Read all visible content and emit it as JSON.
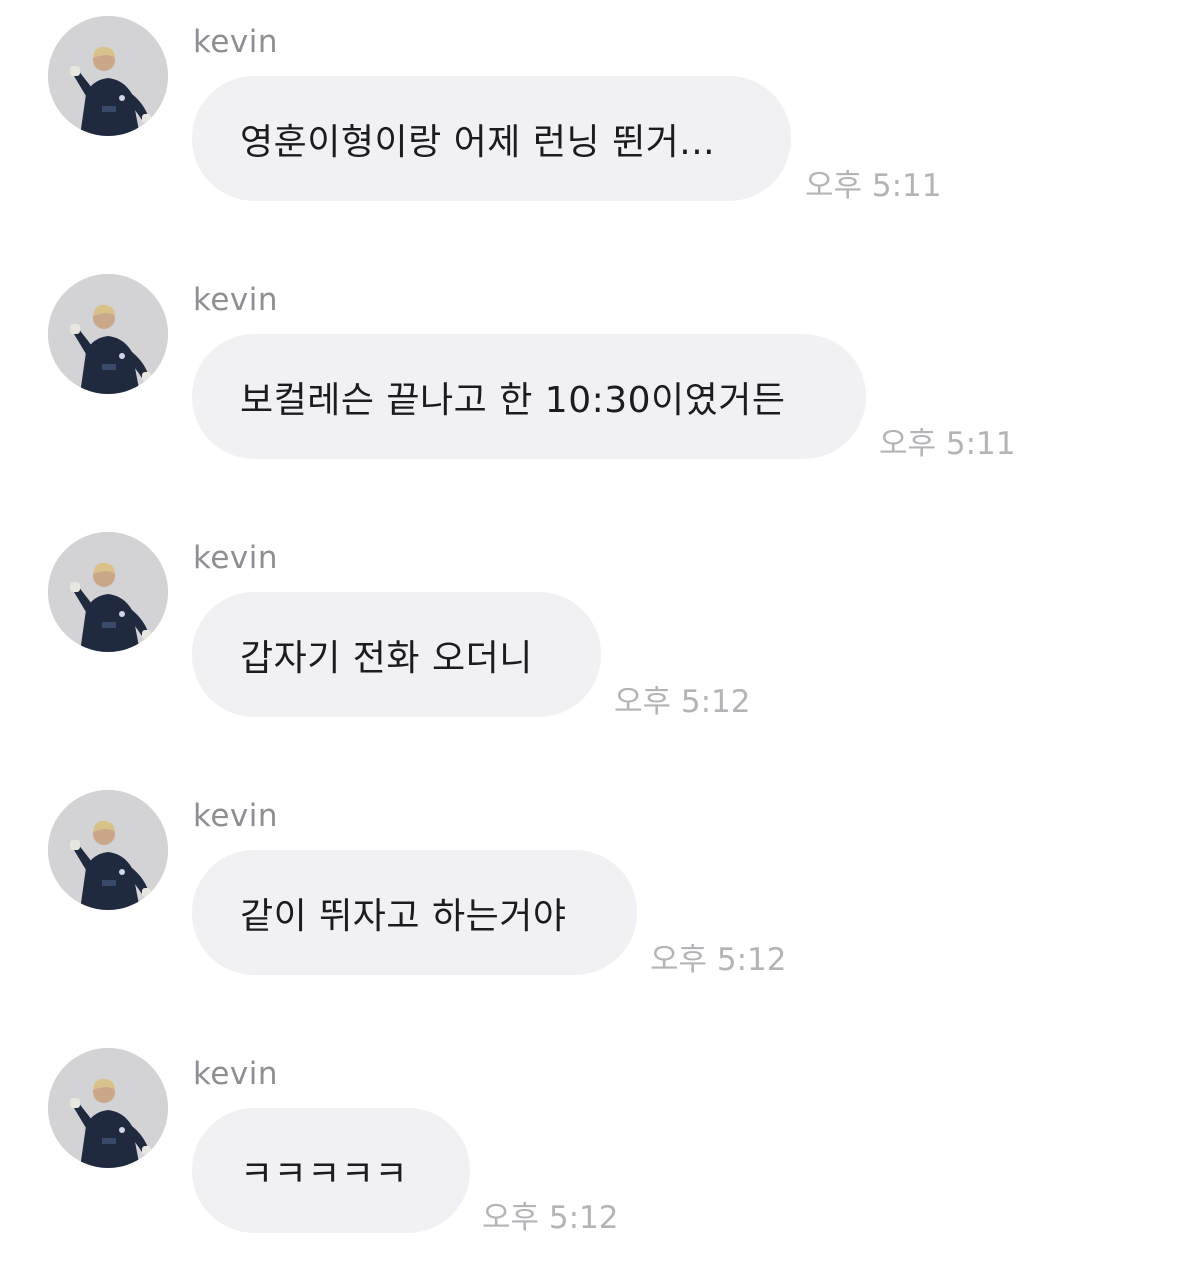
{
  "messages": [
    {
      "sender": "kevin",
      "text": "영훈이형이랑 어제 런닝 뛴거...",
      "time": "오후 5:11"
    },
    {
      "sender": "kevin",
      "text": "보컬레슨 끝나고 한 10:30이였거든",
      "time": "오후 5:11"
    },
    {
      "sender": "kevin",
      "text": "갑자기 전화 오더니",
      "time": "오후 5:12"
    },
    {
      "sender": "kevin",
      "text": "같이 뛰자고 하는거야",
      "time": "오후 5:12"
    },
    {
      "sender": "kevin",
      "text": "ㅋㅋㅋㅋㅋ",
      "time": "오후 5:12"
    }
  ],
  "colors": {
    "bubble_bg": "#f1f1f3",
    "message_text": "#1c1c1e",
    "sender_text": "#8e8e93",
    "time_text": "#b4b4b8",
    "avatar_bg": "#d6d6d8"
  },
  "icons": {
    "avatar": "profile-photo-avatar"
  }
}
